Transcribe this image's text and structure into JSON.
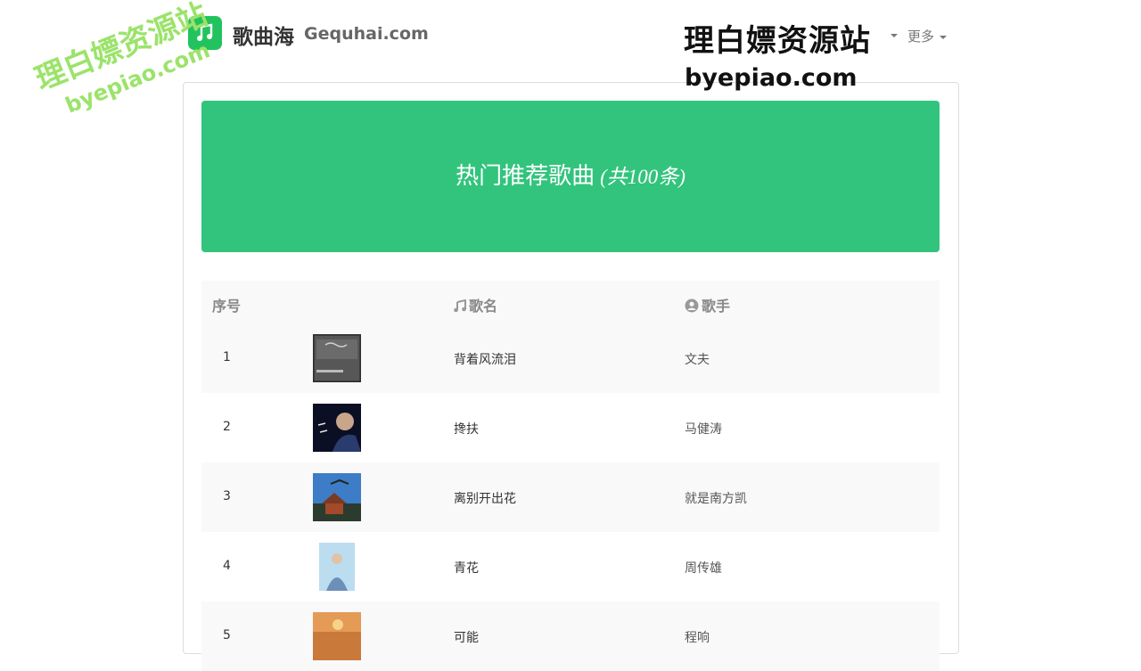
{
  "header": {
    "brand_cn": "歌曲海",
    "brand_en": "Gequhai.com",
    "nav_more": "更多"
  },
  "watermarks": {
    "right_cn": "理白嫖资源站",
    "right_en": "byepiao.com",
    "left_cn": "理白嫖资源站",
    "left_en": "byepiao.com"
  },
  "banner": {
    "title": "热门推荐歌曲",
    "count": "(共100条)"
  },
  "table": {
    "headers": {
      "index": "序号",
      "song": "歌名",
      "artist": "歌手"
    },
    "rows": [
      {
        "index": "1",
        "song": "背着风流泪",
        "artist": "文夫"
      },
      {
        "index": "2",
        "song": "搀扶",
        "artist": "马健涛"
      },
      {
        "index": "3",
        "song": "离别开出花",
        "artist": "就是南方凯"
      },
      {
        "index": "4",
        "song": "青花",
        "artist": "周传雄"
      },
      {
        "index": "5",
        "song": "可能",
        "artist": "程响"
      }
    ]
  },
  "colors": {
    "brand": "#22c35e",
    "banner": "#32c47c",
    "watermark_left": "#9be36a"
  }
}
